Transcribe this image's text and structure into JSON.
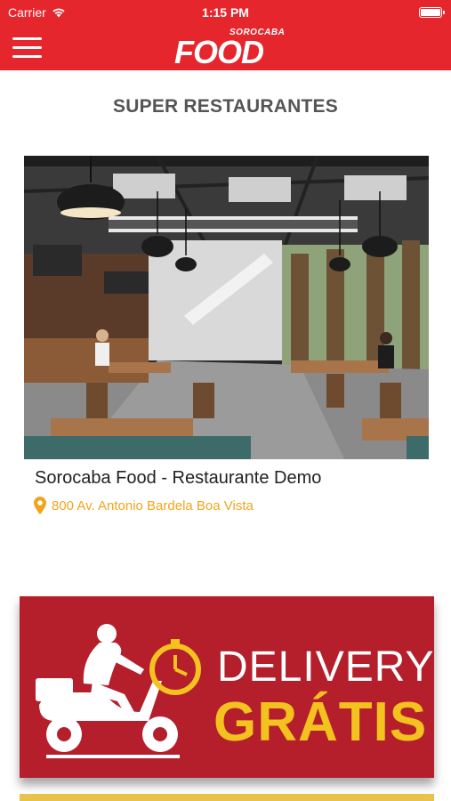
{
  "status_bar": {
    "carrier": "Carrier",
    "time": "1:15 PM"
  },
  "header": {
    "logo_small": "SOROCABA",
    "logo_big": "FOOD"
  },
  "section": {
    "title": "SUPER RESTAURANTES"
  },
  "restaurant": {
    "name": "Sorocaba Food - Restaurante Demo",
    "address": "800 Av. Antonio Bardela Boa Vista"
  },
  "banner": {
    "line1": "DELIVERY",
    "line2": "GRÁTIS"
  },
  "colors": {
    "brand_red": "#e5262d",
    "banner_red": "#b51f2c",
    "accent_yellow": "#f3c21f",
    "address_orange": "#f2a51c"
  }
}
